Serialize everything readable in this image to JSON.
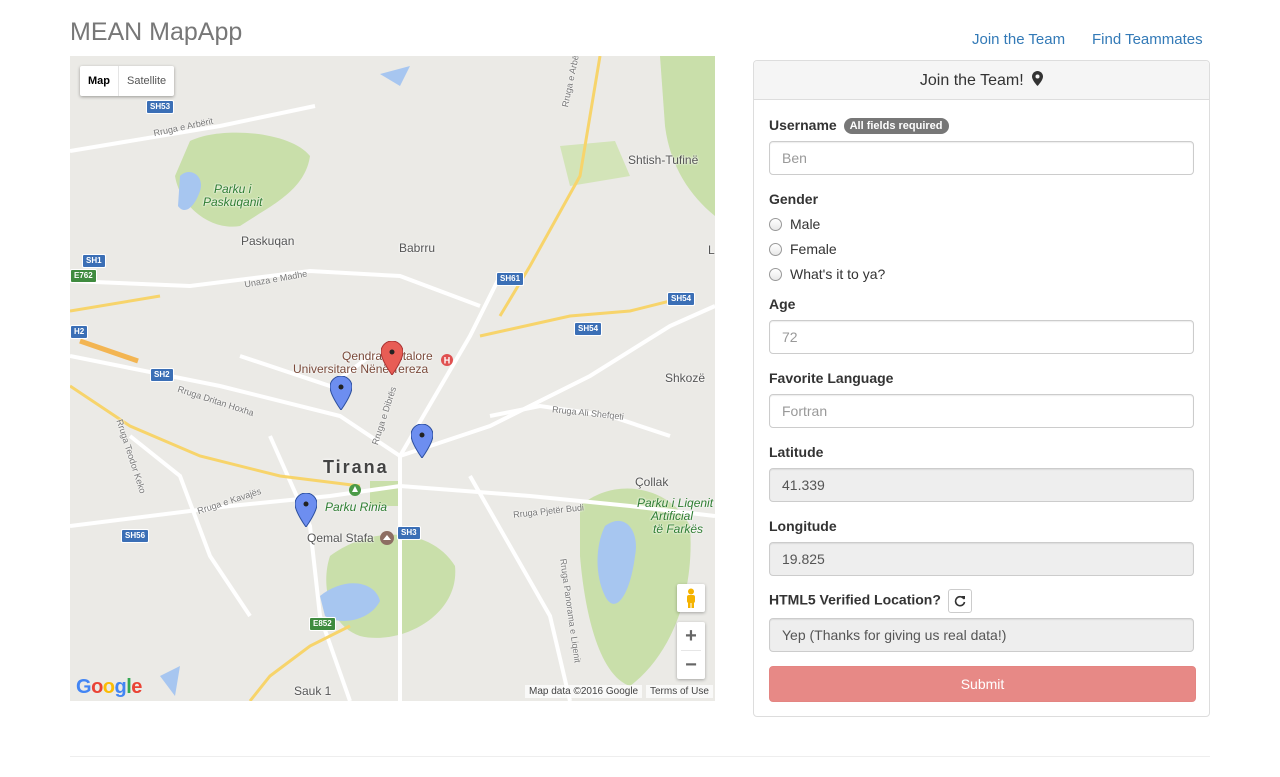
{
  "app": {
    "brand": "MEAN MapApp"
  },
  "nav": {
    "join_label": "Join the Team",
    "find_label": "Find Teammates"
  },
  "map": {
    "type_map": "Map",
    "type_satellite": "Satellite",
    "city": "Tirana",
    "labels": {
      "parku_paskuqanit_1": "Parku i",
      "parku_paskuqanit_2": "Paskuqanit",
      "paskuqan": "Paskuqan",
      "babrru": "Babrru",
      "shtish": "Shtish-Tufinë",
      "hospital_1": "Qendra Spitalore",
      "hospital_2": "Universitare Nënë Tereza",
      "shkoze": "Shkozë",
      "parku_rinia": "Parku Rinia",
      "qemal": "Qemal Stafa",
      "collak": "Çollak",
      "parku_ligenit_1": "Parku i Liqenit",
      "parku_ligenit_2": "Artificial",
      "parku_ligenit_3": "të Farkës",
      "sauk": "Sauk 1",
      "rruga_arbrit_1": "Rruga e Arbërit",
      "rruga_arbrit_2": "Rruga e Arbërit",
      "unaza": "Unaza e Madhe",
      "rruga_dritan": "Rruga Dritan Hoxha",
      "rruga_teodor": "Rruga Teodor Keko",
      "rruga_kavajes": "Rruga e Kavajës",
      "rruga_dibres": "Rruga e Dibrës",
      "rruga_ali": "Rruga Ali Shefqeti",
      "rruga_pjeter": "Rruga Pjetër Budi",
      "rruga_panorama": "Rruga Panorama e Liqenit",
      "letter_l": "L"
    },
    "shields": {
      "sh53": "SH53",
      "sh1": "SH1",
      "e762": "E762",
      "h2": "H2",
      "sh2": "SH2",
      "sh61": "SH61",
      "sh54a": "SH54",
      "sh54b": "SH54",
      "sh56": "SH56",
      "sh3": "SH3",
      "e852": "E852"
    },
    "zoom_in": "+",
    "zoom_out": "−",
    "google": "Google",
    "attribution": "Map data ©2016 Google",
    "terms": "Terms of Use"
  },
  "form": {
    "heading": "Join the Team!",
    "username_label": "Username",
    "required_badge": "All fields required",
    "username_placeholder": "Ben",
    "gender_label": "Gender",
    "gender_options": [
      "Male",
      "Female",
      "What's it to ya?"
    ],
    "age_label": "Age",
    "age_placeholder": "72",
    "language_label": "Favorite Language",
    "language_placeholder": "Fortran",
    "latitude_label": "Latitude",
    "latitude_value": "41.339",
    "longitude_label": "Longitude",
    "longitude_value": "19.825",
    "verified_label": "HTML5 Verified Location?",
    "verified_value": "Yep (Thanks for giving us real data!)",
    "submit_label": "Submit"
  }
}
